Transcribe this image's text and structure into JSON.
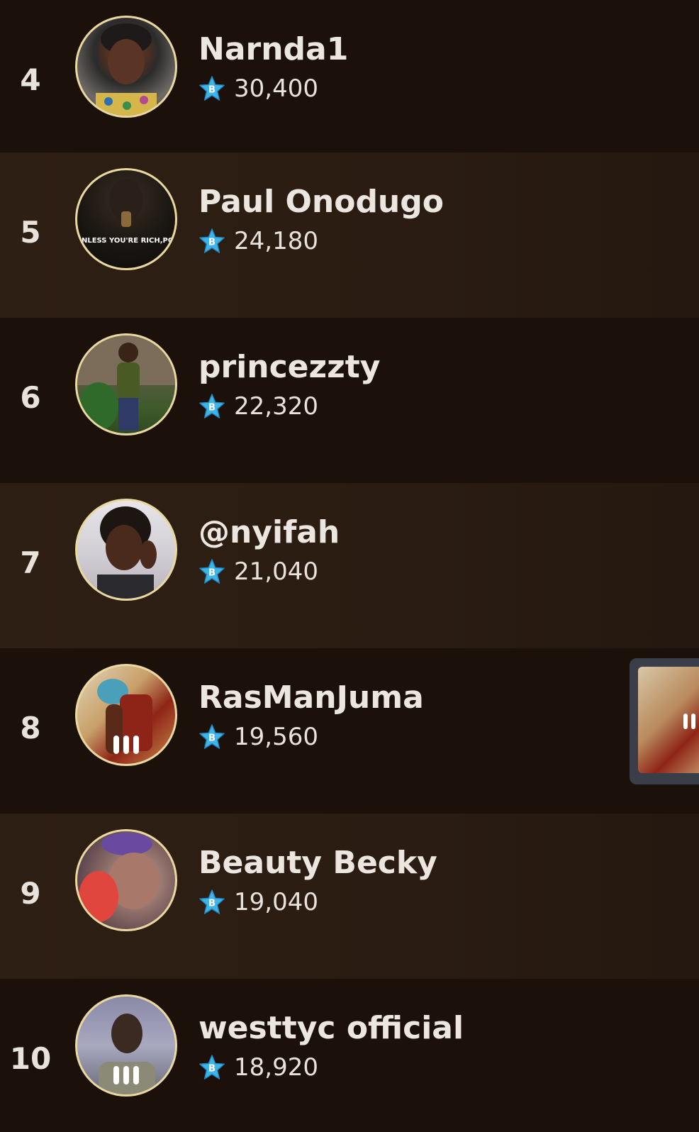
{
  "leaderboard": {
    "rows": [
      {
        "rank": "4",
        "name": "Narnda1",
        "score": "30,400",
        "speaking": false
      },
      {
        "rank": "5",
        "name": "Paul Onodugo",
        "score": "24,180",
        "speaking": false,
        "avatar_text": "NOBODY CARES UNLESS YOU'RE RICH,POPULAR OR DEAD."
      },
      {
        "rank": "6",
        "name": "princezzty",
        "score": "22,320",
        "speaking": false
      },
      {
        "rank": "7",
        "name": "@nyifah",
        "score": "21,040",
        "speaking": false
      },
      {
        "rank": "8",
        "name": "RasManJuma",
        "score": "19,560",
        "speaking": true
      },
      {
        "rank": "9",
        "name": "Beauty Becky",
        "score": "19,040",
        "speaking": false
      },
      {
        "rank": "10",
        "name": "westtyc official",
        "score": "18,920",
        "speaking": true
      }
    ]
  },
  "icons": {
    "score": "b-star-icon",
    "speaking": "audio-bars-icon"
  },
  "colors": {
    "row_dark": "#1b110a",
    "row_light": "#2e1f14",
    "avatar_border": "#e9d9a0",
    "star": "#3fb4e8",
    "text": "#ece6e0"
  }
}
